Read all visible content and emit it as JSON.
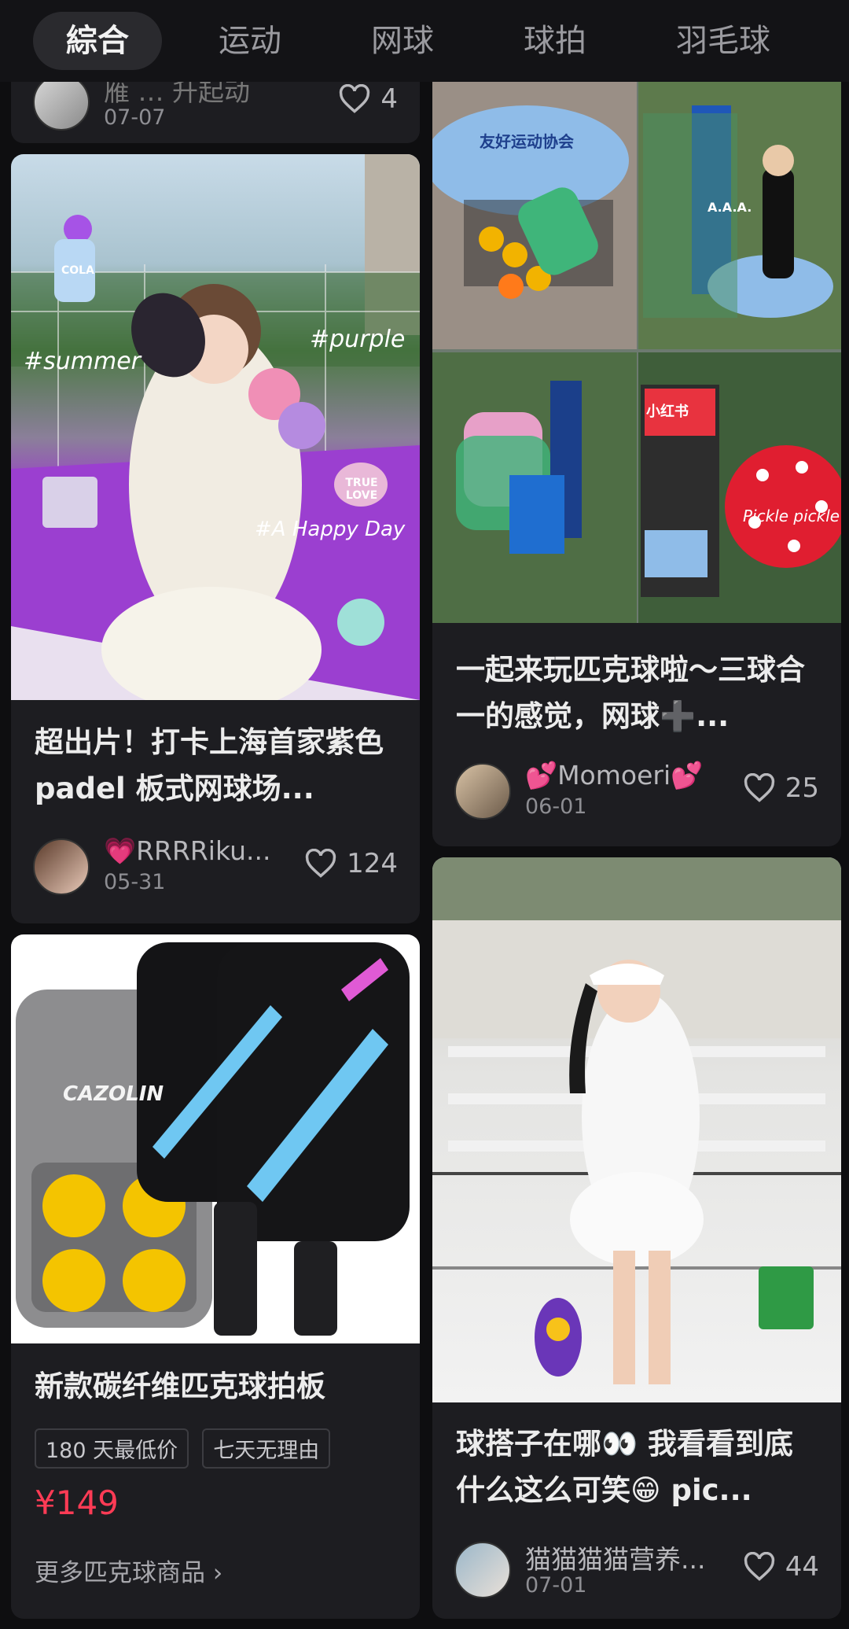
{
  "tabs": [
    "綜合",
    "运动",
    "网球",
    "球拍",
    "羽毛球"
  ],
  "cards": {
    "top_partial": {
      "author": "雁 … 升起动",
      "date": "07-07",
      "likes": "4"
    },
    "padel": {
      "title": "超出片！打卡上海首家紫色 padel 板式网球场...",
      "author": "💗RRRRiku...",
      "date": "05-31",
      "likes": "124",
      "overlay": [
        "#summer",
        "#purple",
        "#A Happy Day",
        "COLA",
        "TRUE LOVE"
      ]
    },
    "pickleball_event": {
      "title": "一起来玩匹克球啦～三球合一的感觉，网球➕...",
      "author": "💕Momoeri💕",
      "date": "06-01",
      "likes": "25",
      "banner_text": [
        "友好运动协会",
        "A.A.A.",
        "小红书",
        "Pickle pickle"
      ]
    },
    "product": {
      "title": "新款碳纤维匹克球拍板",
      "tags": [
        "180 天最低价",
        "七天无理由"
      ],
      "price": "¥149",
      "more": "更多匹克球商品 ›",
      "brand": "CAZOLIN"
    },
    "tennis_girl": {
      "title": "球搭子在哪👀 我看看到底什么这么可笑😁 pic...",
      "author": "猫猫猫猫营养...",
      "date": "07-01",
      "likes": "44"
    }
  },
  "colors": {
    "background": "#0e0e10",
    "card": "#1d1d21",
    "price": "#ff3b55",
    "accent_tab": "#2a2a2e"
  }
}
